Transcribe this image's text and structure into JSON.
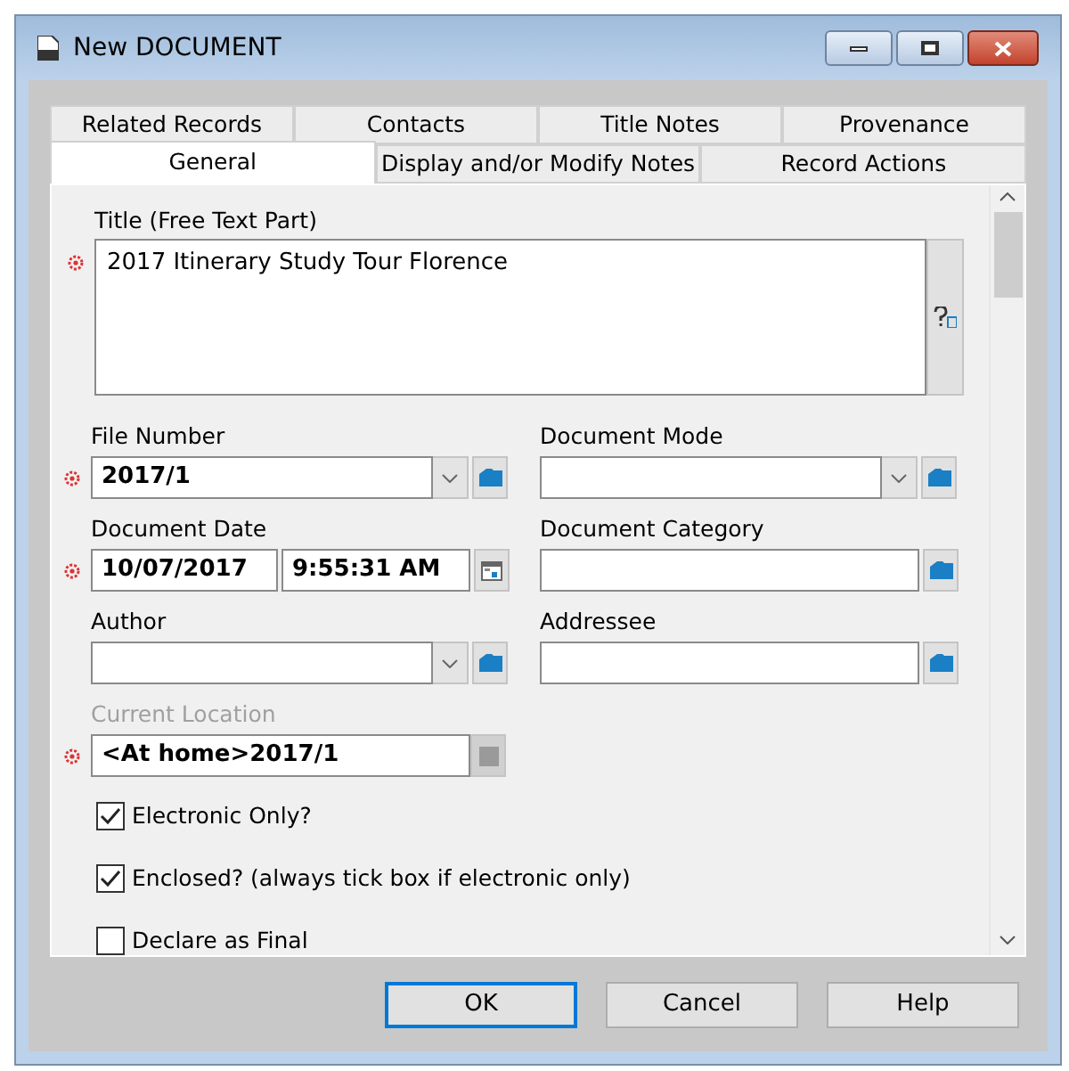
{
  "window": {
    "title": "New DOCUMENT"
  },
  "tab_rows": [
    [
      {
        "label": "Related Records",
        "selected": false
      },
      {
        "label": "Contacts",
        "selected": false
      },
      {
        "label": "Title Notes",
        "selected": false
      },
      {
        "label": "Provenance",
        "selected": false
      }
    ],
    [
      {
        "label": "General",
        "selected": true
      },
      {
        "label": "Display and/or Modify Notes",
        "selected": false
      },
      {
        "label": "Record Actions",
        "selected": false
      }
    ]
  ],
  "title_field": {
    "label": "Title (Free Text Part)",
    "value": "2017 Itinerary Study Tour Florence",
    "required": true
  },
  "field_rows": [
    [
      {
        "kind": "combo",
        "label": "File Number",
        "value": "2017/1",
        "required": true,
        "disabled": false
      },
      {
        "kind": "combo",
        "label": "Document Mode",
        "required": false,
        "disabled": false
      }
    ],
    [
      {
        "kind": "datetime",
        "label": "Document Date",
        "value": "10/07/2017",
        "time": "9:55:31 AM",
        "required": true,
        "disabled": false
      },
      {
        "kind": "lookup",
        "label": "Document Category",
        "required": false,
        "disabled": false
      }
    ],
    [
      {
        "kind": "combo",
        "label": "Author",
        "required": false,
        "disabled": false
      },
      {
        "kind": "lookup",
        "label": "Addressee",
        "required": false,
        "disabled": false
      }
    ],
    [
      {
        "kind": "location",
        "label": "Current Location",
        "value": "<At home>2017/1",
        "required": true,
        "disabled": true
      }
    ]
  ],
  "checkboxes": [
    {
      "label": "Electronic Only?",
      "checked": true
    },
    {
      "label": "Enclosed? (always tick box if electronic only)",
      "checked": true
    },
    {
      "label": "Declare as Final",
      "checked": false
    }
  ],
  "buttons": [
    {
      "label": "OK",
      "default": true
    },
    {
      "label": "Cancel",
      "default": false
    },
    {
      "label": "Help",
      "default": false
    }
  ]
}
